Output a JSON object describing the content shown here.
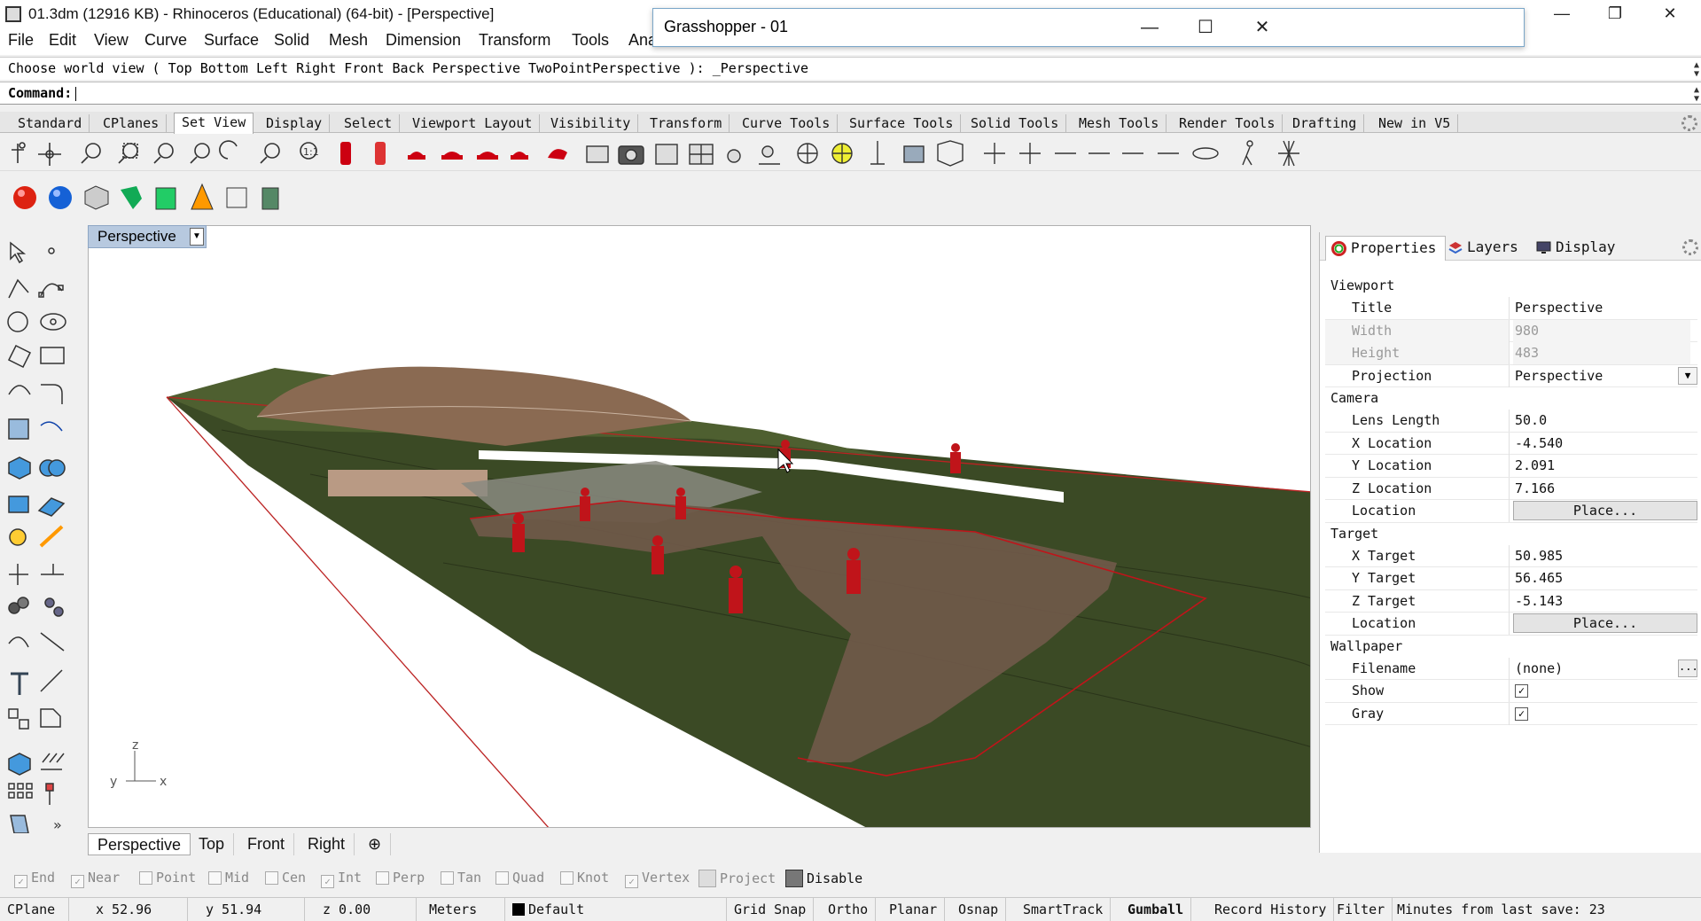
{
  "window": {
    "title": "01.3dm (12916 KB) - Rhinoceros (Educational) (64-bit) - [Perspective]",
    "minimize": "—",
    "restore": "❐",
    "close": "✕"
  },
  "menu": [
    "File",
    "Edit",
    "View",
    "Curve",
    "Surface",
    "Solid",
    "Mesh",
    "Dimension",
    "Transform",
    "Tools",
    "Ana"
  ],
  "grasshopper": {
    "title": "Grasshopper - 01",
    "minimize": "—",
    "maximize": "☐",
    "close": "✕"
  },
  "command": {
    "history": "Choose world view ( Top  Bottom  Left  Right  Front  Back  Perspective  TwoPointPerspective ): _Perspective",
    "prompt": "Command:"
  },
  "toolbar_tabs": [
    "Standard",
    "CPlanes",
    "Set View",
    "Display",
    "Select",
    "Viewport Layout",
    "Visibility",
    "Transform",
    "Curve Tools",
    "Surface Tools",
    "Solid Tools",
    "Mesh Tools",
    "Render Tools",
    "Drafting",
    "New in V5"
  ],
  "active_toolbar_tab": "Set View",
  "viewport": {
    "name": "Perspective",
    "axis_labels": {
      "z": "z",
      "y": "y",
      "x": "x"
    }
  },
  "viewport_tabs": [
    "Perspective",
    "Top",
    "Front",
    "Right"
  ],
  "viewport_add": "⊕",
  "panel": {
    "tabs": [
      "Properties",
      "Layers",
      "Display"
    ],
    "sections": {
      "viewport": "Viewport",
      "camera": "Camera",
      "target": "Target",
      "wallpaper": "Wallpaper"
    },
    "title_label": "Title",
    "title_value": "Perspective",
    "width_label": "Width",
    "width_value": "980",
    "height_label": "Height",
    "height_value": "483",
    "projection_label": "Projection",
    "projection_value": "Perspective",
    "lens_label": "Lens Length",
    "lens_value": "50.0",
    "xloc_label": "X Location",
    "xloc_value": "-4.540",
    "yloc_label": "Y Location",
    "yloc_value": "2.091",
    "zloc_label": "Z Location",
    "zloc_value": "7.166",
    "location_label": "Location",
    "place_button": "Place...",
    "xtgt_label": "X Target",
    "xtgt_value": "50.985",
    "ytgt_label": "Y Target",
    "ytgt_value": "56.465",
    "ztgt_label": "Z Target",
    "ztgt_value": "-5.143",
    "tlocation_label": "Location",
    "tplace_button": "Place...",
    "filename_label": "Filename",
    "filename_value": "(none)",
    "show_label": "Show",
    "gray_label": "Gray",
    "dots": "..."
  },
  "osnap": [
    {
      "label": "End",
      "checked": true
    },
    {
      "label": "Near",
      "checked": true
    },
    {
      "label": "Point",
      "checked": false
    },
    {
      "label": "Mid",
      "checked": false
    },
    {
      "label": "Cen",
      "checked": false
    },
    {
      "label": "Int",
      "checked": true
    },
    {
      "label": "Perp",
      "checked": false
    },
    {
      "label": "Tan",
      "checked": false
    },
    {
      "label": "Quad",
      "checked": false
    },
    {
      "label": "Knot",
      "checked": false
    },
    {
      "label": "Vertex",
      "checked": true
    },
    {
      "label": "Project",
      "checked": false
    },
    {
      "label": "Disable",
      "checked": false
    }
  ],
  "status": {
    "cplane": "CPlane",
    "x": "x 52.96",
    "y": "y 51.94",
    "z": "z 0.00",
    "units": "Meters",
    "layer": "Default",
    "grid_snap": "Grid Snap",
    "ortho": "Ortho",
    "planar": "Planar",
    "osnap": "Osnap",
    "smarttrack": "SmartTrack",
    "gumball": "Gumball",
    "record_history": "Record History",
    "filter": "Filter",
    "save": "Minutes from last save: 23"
  },
  "colors": {
    "terrain": "#3b4a25",
    "model_red": "#c0141a",
    "ramp_brown": "#6e5848",
    "viewport_tab": "#b7c9df"
  }
}
